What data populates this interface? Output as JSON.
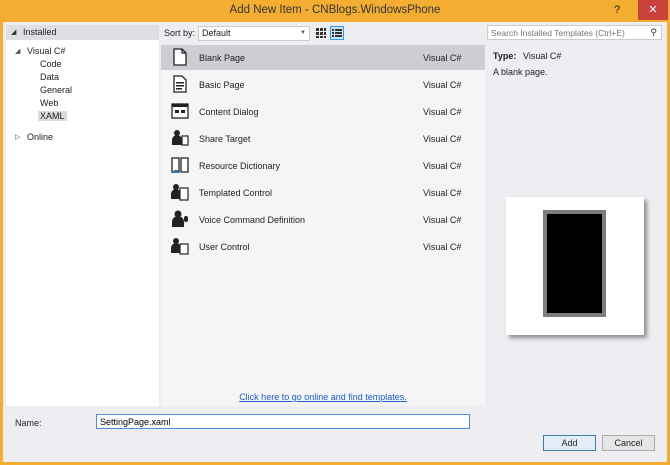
{
  "window": {
    "title": "Add New Item - CNBlogs.WindowsPhone",
    "help_label": "?",
    "close_label": "✕"
  },
  "tree": {
    "installed_label": "Installed",
    "root_label": "Visual C#",
    "children": [
      "Code",
      "Data",
      "General",
      "Web",
      "XAML"
    ],
    "selected": "XAML",
    "online_label": "Online"
  },
  "toolbar": {
    "sort_label": "Sort by:",
    "sort_value": "Default",
    "search_placeholder": "Search Installed Templates (Ctrl+E)"
  },
  "templates": [
    {
      "name": "Blank Page",
      "lang": "Visual C#",
      "icon": "page-icon",
      "selected": true
    },
    {
      "name": "Basic Page",
      "lang": "Visual C#",
      "icon": "basic-page-icon"
    },
    {
      "name": "Content Dialog",
      "lang": "Visual C#",
      "icon": "dialog-icon"
    },
    {
      "name": "Share Target",
      "lang": "Visual C#",
      "icon": "share-icon"
    },
    {
      "name": "Resource Dictionary",
      "lang": "Visual C#",
      "icon": "book-icon"
    },
    {
      "name": "Templated Control",
      "lang": "Visual C#",
      "icon": "control-icon"
    },
    {
      "name": "Voice Command Definition",
      "lang": "Visual C#",
      "icon": "voice-icon"
    },
    {
      "name": "User Control",
      "lang": "Visual C#",
      "icon": "user-control-icon"
    }
  ],
  "online_link": "Click here to go online and find templates.",
  "details": {
    "type_label": "Type:",
    "type_value": "Visual C#",
    "description": "A blank page."
  },
  "name_field": {
    "label": "Name:",
    "value": "SettingPage.xaml"
  },
  "buttons": {
    "add": "Add",
    "cancel": "Cancel"
  },
  "colors": {
    "title_bar": "#f3ae31",
    "close": "#c8423b",
    "selection": "#ccced3",
    "link": "#1e5bd6"
  }
}
